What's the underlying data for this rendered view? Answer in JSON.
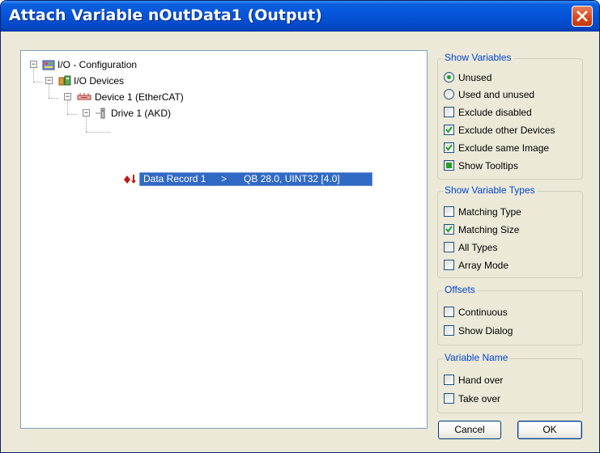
{
  "window": {
    "title": "Attach Variable nOutData1 (Output)"
  },
  "tree": {
    "items": [
      {
        "label": "I/O - Configuration",
        "icon": "io-config-icon",
        "expander": "−"
      },
      {
        "label": "I/O Devices",
        "icon": "io-devices-icon",
        "expander": "−"
      },
      {
        "label": "Device 1 (EtherCAT)",
        "icon": "ethercat-device-icon",
        "expander": "−"
      },
      {
        "label": "Drive 1 (AKD)",
        "icon": "drive-icon",
        "expander": "−"
      }
    ],
    "selected": {
      "name": "Data Record 1",
      "arrow": ">",
      "value": "QB 28.0, UINT32 [4.0]",
      "icon": "output-variable-icon"
    }
  },
  "show_variables": {
    "title": "Show Variables",
    "options": [
      {
        "label": "Unused",
        "type": "radio",
        "checked": true
      },
      {
        "label": "Used and unused",
        "type": "radio",
        "checked": false
      },
      {
        "label": "Exclude disabled",
        "type": "checkbox",
        "checked": false
      },
      {
        "label": "Exclude other Devices",
        "type": "checkbox",
        "checked": true
      },
      {
        "label": "Exclude same Image",
        "type": "checkbox",
        "checked": true
      },
      {
        "label": "Show Tooltips",
        "type": "checkbox",
        "checked": "indeterminate"
      }
    ]
  },
  "show_variable_types": {
    "title": "Show Variable Types",
    "options": [
      {
        "label": "Matching Type",
        "checked": false
      },
      {
        "label": "Matching Size",
        "checked": true
      },
      {
        "label": "All Types",
        "checked": false
      },
      {
        "label": "Array Mode",
        "checked": false
      }
    ]
  },
  "offsets": {
    "title": "Offsets",
    "options": [
      {
        "label": "Continuous",
        "checked": false
      },
      {
        "label": "Show Dialog",
        "checked": false
      }
    ]
  },
  "variable_name": {
    "title": "Variable Name",
    "options": [
      {
        "label": "Hand over",
        "checked": false
      },
      {
        "label": "Take over",
        "checked": false
      }
    ]
  },
  "buttons": {
    "cancel": "Cancel",
    "ok": "OK"
  },
  "colors": {
    "titlebar": "#0553d8",
    "selection": "#316ac5",
    "group_title": "#0046d5",
    "check": "#21a121"
  }
}
